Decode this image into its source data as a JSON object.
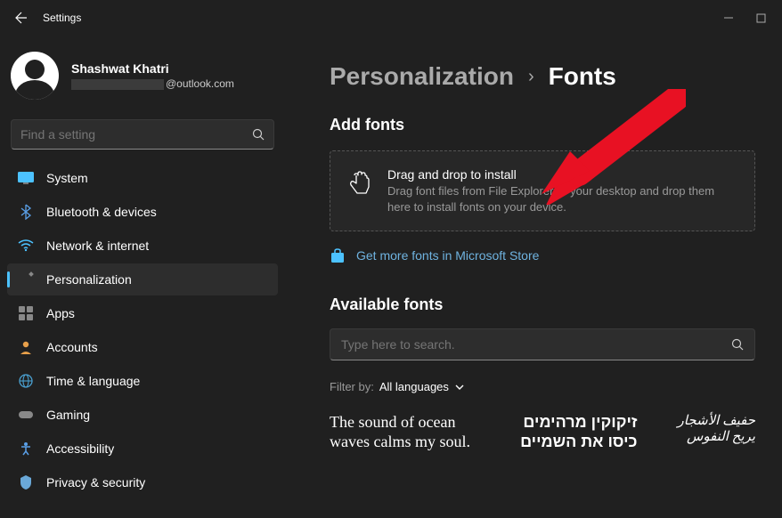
{
  "titlebar": {
    "title": "Settings"
  },
  "profile": {
    "name": "Shashwat Khatri",
    "email_suffix": "@outlook.com"
  },
  "search": {
    "placeholder": "Find a setting"
  },
  "nav": {
    "items": [
      {
        "label": "System",
        "icon": "system"
      },
      {
        "label": "Bluetooth & devices",
        "icon": "bluetooth"
      },
      {
        "label": "Network & internet",
        "icon": "wifi"
      },
      {
        "label": "Personalization",
        "icon": "brush"
      },
      {
        "label": "Apps",
        "icon": "apps"
      },
      {
        "label": "Accounts",
        "icon": "person"
      },
      {
        "label": "Time & language",
        "icon": "globe"
      },
      {
        "label": "Gaming",
        "icon": "gamepad"
      },
      {
        "label": "Accessibility",
        "icon": "access"
      },
      {
        "label": "Privacy & security",
        "icon": "shield"
      }
    ],
    "selected_index": 3
  },
  "breadcrumb": {
    "parent": "Personalization",
    "current": "Fonts"
  },
  "add_fonts": {
    "title": "Add fonts",
    "drop_title": "Drag and drop to install",
    "drop_desc": "Drag font files from File Explorer or your desktop and drop them here to install fonts on your device.",
    "store_link": "Get more fonts in Microsoft Store"
  },
  "available": {
    "title": "Available fonts",
    "search_placeholder": "Type here to search.",
    "filter_label": "Filter by:",
    "filter_value": "All languages",
    "previews": [
      "The sound of ocean waves calms my soul.",
      "זיקוקין מרהימים כיסו את השמיים",
      "حفيف الأشجار يريح النفوس"
    ]
  }
}
